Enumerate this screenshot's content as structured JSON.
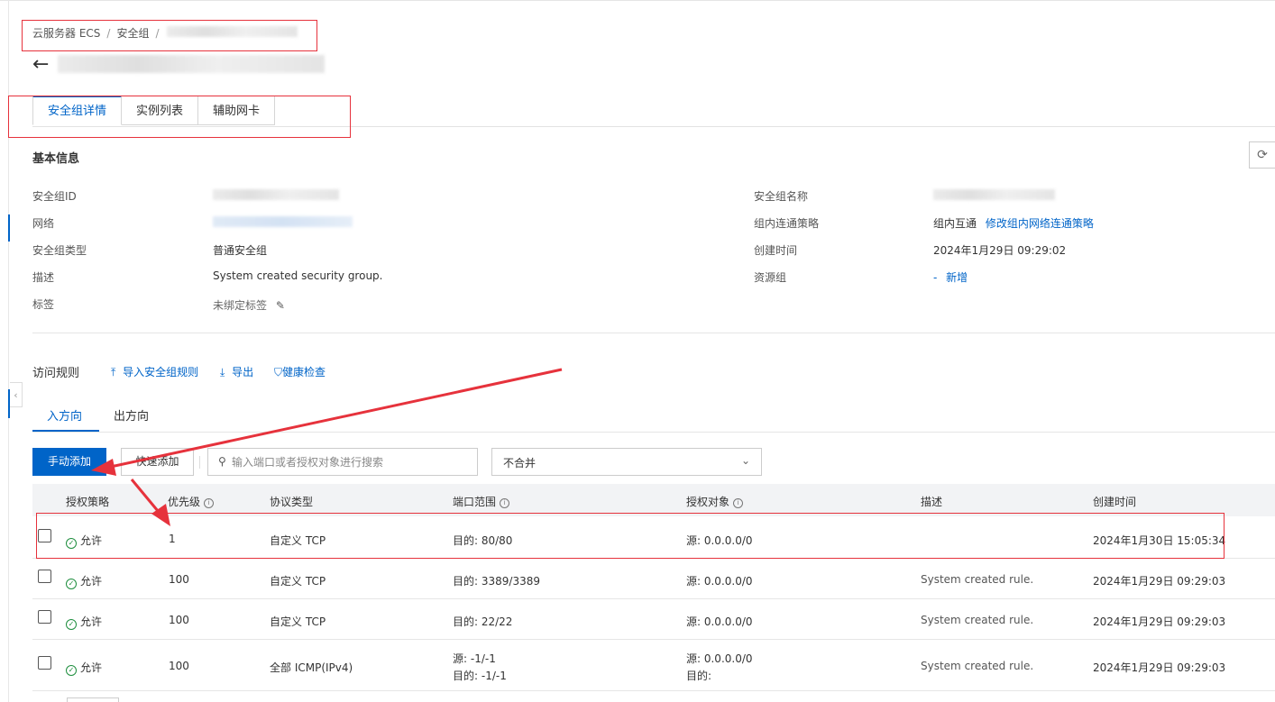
{
  "breadcrumb": {
    "item1": "云服务器 ECS",
    "sep": "/",
    "item2": "安全组",
    "sep2": "/"
  },
  "header": {
    "back_icon": "←"
  },
  "tabs": [
    {
      "label": "安全组详情"
    },
    {
      "label": "实例列表"
    },
    {
      "label": "辅助网卡"
    }
  ],
  "basic_info": {
    "title": "基本信息",
    "refresh_icon": "⟳",
    "fields_left": [
      {
        "label": "安全组ID"
      },
      {
        "label": "网络"
      },
      {
        "label": "安全组类型",
        "value": "普通安全组"
      },
      {
        "label": "描述",
        "value": "System created security group."
      },
      {
        "label": "标签",
        "value": "未绑定标签"
      }
    ],
    "fields_right": [
      {
        "label": "安全组名称"
      },
      {
        "label": "组内连通策略",
        "value": "组内互通",
        "link": "修改组内网络连通策略"
      },
      {
        "label": "创建时间",
        "value": "2024年1月29日 09:29:02"
      },
      {
        "label": "资源组",
        "value": "-",
        "link": "新增"
      }
    ]
  },
  "rules": {
    "title": "访问规则",
    "actions": [
      {
        "label": "导入安全组规则",
        "icon": "⤒"
      },
      {
        "label": "导出",
        "icon": "⤓"
      },
      {
        "label": "健康检查",
        "icon": "⛉"
      }
    ],
    "direction_tabs": [
      {
        "label": "入方向"
      },
      {
        "label": "出方向"
      }
    ],
    "add_button": "手动添加",
    "quick_add_button": "快速添加",
    "search_placeholder": "输入端口或者授权对象进行搜索",
    "merge_select": "不合并",
    "columns": [
      "授权策略",
      "优先级",
      "协议类型",
      "端口范围",
      "授权对象",
      "描述",
      "创建时间"
    ],
    "rows": [
      {
        "policy": "允许",
        "priority": "1",
        "protocol": "自定义 TCP",
        "port": "目的: 80/80",
        "port2": "",
        "source": "源: 0.0.0.0/0",
        "source2": "",
        "desc": "",
        "created": "2024年1月30日 15:05:34"
      },
      {
        "policy": "允许",
        "priority": "100",
        "protocol": "自定义 TCP",
        "port": "目的: 3389/3389",
        "port2": "",
        "source": "源: 0.0.0.0/0",
        "source2": "",
        "desc": "System created rule.",
        "created": "2024年1月29日 09:29:03"
      },
      {
        "policy": "允许",
        "priority": "100",
        "protocol": "自定义 TCP",
        "port": "目的: 22/22",
        "port2": "",
        "source": "源: 0.0.0.0/0",
        "source2": "",
        "desc": "System created rule.",
        "created": "2024年1月29日 09:29:03"
      },
      {
        "policy": "允许",
        "priority": "100",
        "protocol": "全部 ICMP(IPv4)",
        "port": "源: -1/-1",
        "port2": "目的: -1/-1",
        "source": "源: 0.0.0.0/0",
        "source2": "目的:",
        "desc": "System created rule.",
        "created": "2024年1月29日 09:29:03"
      }
    ]
  },
  "colors": {
    "accent": "#0064c8",
    "annotation": "#e6323c",
    "allow": "#1e8e3e"
  }
}
